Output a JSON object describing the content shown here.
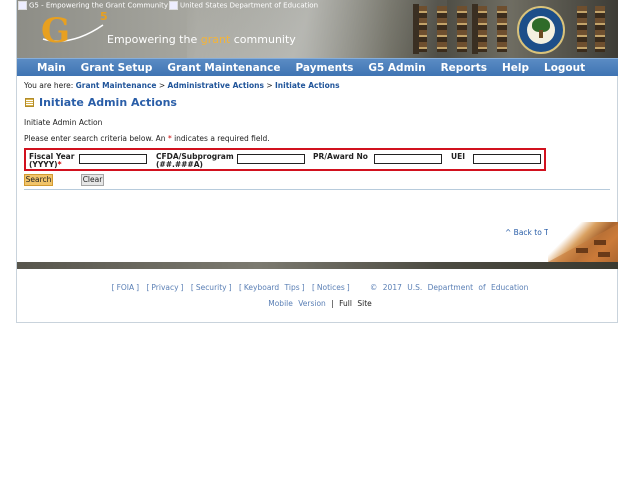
{
  "banner": {
    "alt_logo": "G5 - Empowering the Grant Community",
    "alt_agency": "United States Department of Education",
    "logo_letter": "G",
    "logo_sup": "5",
    "tagline_pre": "Empowering the ",
    "tagline_hl": "grant",
    "tagline_post": " community"
  },
  "nav": [
    "Main",
    "Grant Setup",
    "Grant Maintenance",
    "Payments",
    "G5 Admin",
    "Reports",
    "Help",
    "Logout"
  ],
  "breadcrumb": {
    "prefix": "You are here: ",
    "items": [
      "Grant Maintenance",
      "Administrative Actions",
      "Initiate Actions"
    ],
    "separator": " > "
  },
  "page_title": "Initiate Admin Actions",
  "section_label": "Initiate Admin Action",
  "instructions": {
    "pre": "Please enter search criteria below. An ",
    "marker": "*",
    "post": " indicates a required field."
  },
  "form": {
    "fiscal_year_label_1": "Fiscal Year",
    "fiscal_year_label_2": "(YYYY)",
    "fiscal_year_value": "",
    "cfda_label_1": "CFDA/Subprogram",
    "cfda_label_2": "(##.###A)",
    "cfda_value": "",
    "award_label": "PR/Award No",
    "award_value": "",
    "uei_label": "UEI",
    "uei_value": ""
  },
  "buttons": {
    "search": "Search",
    "clear": "Clear"
  },
  "back_to_top": "^ Back to Top",
  "footer": {
    "links": [
      "FOIA",
      "Privacy",
      "Security",
      "Keyboard Tips",
      "Notices"
    ],
    "copyright": "© 2017 U.S. Department of Education",
    "mobile": "Mobile Version",
    "separator": "|",
    "full": "Full Site"
  },
  "colors": {
    "nav_bg": "#4a7fbf",
    "title": "#2a5ea8",
    "highlight_box": "#d1111e",
    "search_button": "#f1c46a"
  }
}
